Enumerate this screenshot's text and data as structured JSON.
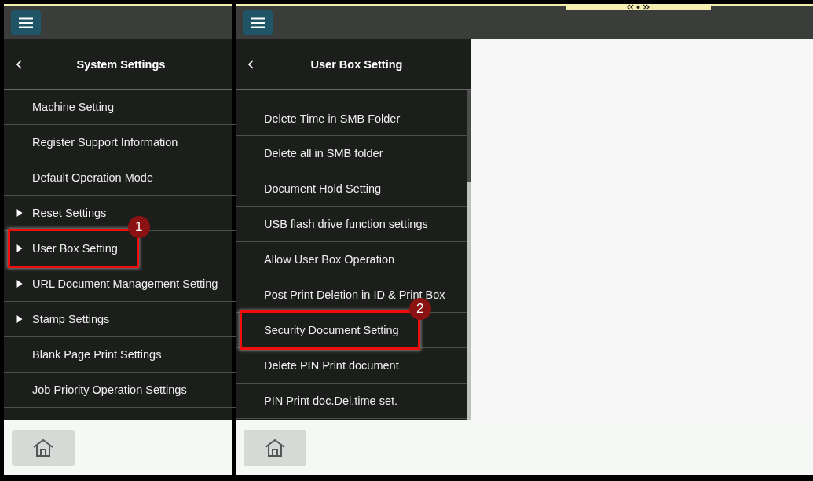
{
  "panels": [
    {
      "title": "System Settings",
      "has_content_area": false,
      "top_handle": false,
      "scrolled": false,
      "items": [
        {
          "label": "Machine Setting",
          "expandable": false,
          "highlighted": false
        },
        {
          "label": "Register Support Information",
          "expandable": false,
          "highlighted": false
        },
        {
          "label": "Default Operation Mode",
          "expandable": false,
          "highlighted": false
        },
        {
          "label": "Reset Settings",
          "expandable": true,
          "highlighted": false
        },
        {
          "label": "User Box Setting",
          "expandable": true,
          "highlighted": true,
          "callout": "1"
        },
        {
          "label": "URL Document Management Setting",
          "expandable": true,
          "highlighted": false
        },
        {
          "label": "Stamp Settings",
          "expandable": true,
          "highlighted": false
        },
        {
          "label": "Blank Page Print Settings",
          "expandable": false,
          "highlighted": false
        },
        {
          "label": "Job Priority Operation Settings",
          "expandable": false,
          "highlighted": false
        }
      ]
    },
    {
      "title": "User Box Setting",
      "has_content_area": true,
      "top_handle": true,
      "scrolled": true,
      "items": [
        {
          "label": "Delete Time in SMB Folder",
          "expandable": false,
          "highlighted": false
        },
        {
          "label": "Delete all in SMB folder",
          "expandable": false,
          "highlighted": false
        },
        {
          "label": "Document Hold Setting",
          "expandable": false,
          "highlighted": false
        },
        {
          "label": "USB flash drive function settings",
          "expandable": false,
          "highlighted": false
        },
        {
          "label": "Allow User Box Operation",
          "expandable": false,
          "highlighted": false
        },
        {
          "label": "Post Print Deletion in ID & Print Box",
          "expandable": false,
          "highlighted": false
        },
        {
          "label": "Security Document Setting",
          "expandable": false,
          "highlighted": true,
          "callout": "2"
        },
        {
          "label": "Delete PIN Print document",
          "expandable": false,
          "highlighted": false
        },
        {
          "label": "PIN Print doc.Del.time set.",
          "expandable": false,
          "highlighted": false
        }
      ]
    }
  ]
}
